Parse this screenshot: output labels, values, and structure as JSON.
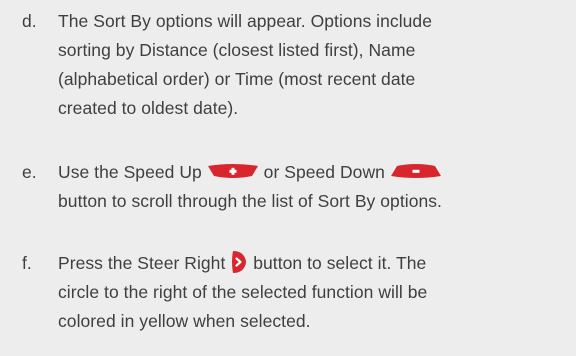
{
  "steps": [
    {
      "letter": "d.",
      "lines": [
        "The Sort By options will appear. Options include",
        "sorting by Distance (closest listed first), Name",
        "(alphabetical order) or Time (most recent date",
        "created to oldest date)."
      ]
    },
    {
      "letter": "e.",
      "line1_a": "Use the Speed Up",
      "line1_b": "or Speed Down",
      "line2": "button to scroll through the list of Sort By options.",
      "icons": [
        "speed-up-icon",
        "speed-down-icon"
      ]
    },
    {
      "letter": "f.",
      "line1_a": "Press the Steer Right",
      "line1_b": "button to select it. The",
      "line2": "circle to the right of the selected function will be",
      "line3": "colored in yellow when selected.",
      "icons": [
        "steer-right-icon"
      ]
    }
  ],
  "colors": {
    "background": "#ededed",
    "text": "#3f3f3f",
    "icon_red": "#d9262e",
    "icon_white": "#ffffff"
  }
}
